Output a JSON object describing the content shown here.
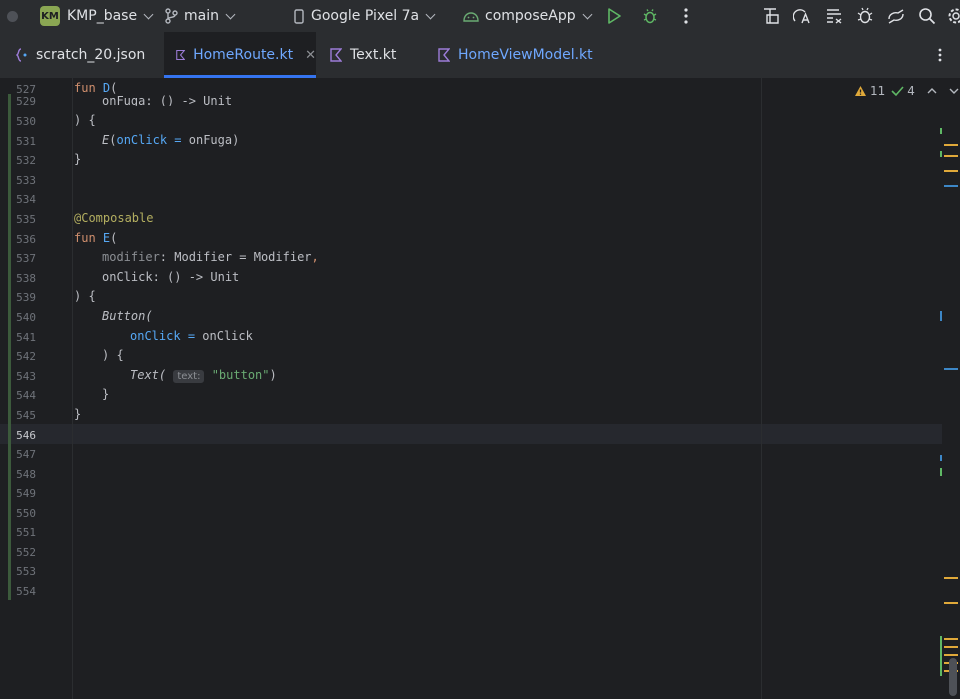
{
  "toolbar": {
    "project_badge": "KM",
    "project_name": "KMP_base",
    "branch": "main",
    "device": "Google Pixel 7a",
    "run_config": "composeApp"
  },
  "tabs": [
    {
      "label": "scratch_20.json",
      "icon": "json-file-icon"
    },
    {
      "label": "HomeRoute.kt",
      "icon": "kotlin-file-icon",
      "active": true
    },
    {
      "label": "Text.kt",
      "icon": "kotlin-file-icon"
    },
    {
      "label": "HomeViewModel.kt",
      "icon": "kotlin-file-icon"
    }
  ],
  "inspections": {
    "warnings": "11",
    "weak_warnings": "4"
  },
  "line_numbers": [
    "527",
    "529",
    "530",
    "531",
    "532",
    "533",
    "534",
    "535",
    "536",
    "537",
    "538",
    "539",
    "540",
    "541",
    "542",
    "543",
    "544",
    "545",
    "546",
    "547",
    "548",
    "549",
    "550",
    "551",
    "552",
    "553",
    "554"
  ],
  "code": {
    "l527_kw": "fun",
    "l527_name": "D",
    "l529": "onFuga: () -> Unit",
    "l530": ") {",
    "l531_fn": "E",
    "l531_param": "onClick",
    "l531_rest": "onFuga)",
    "l532": "}",
    "l535": "@Composable",
    "l536_kw": "fun",
    "l536_name": "E",
    "l537_param": "modifier",
    "l537_rest": ": Modifier = Modifier",
    "l538": "onClick: () -> Unit",
    "l539": ") {",
    "l540": "Button(",
    "l541_param": "onClick",
    "l541_rest": "onClick",
    "l542": ") {",
    "l543_fn": "Text(",
    "l543_hint": "text:",
    "l543_str": "\"button\"",
    "l544": "}",
    "l545": "}"
  },
  "colors": {
    "accent": "#3574f0",
    "keyword": "#cf8e6d",
    "function": "#56a8f5",
    "annotation": "#b3ae60",
    "string": "#6aab73",
    "warning": "#e0a93a"
  }
}
